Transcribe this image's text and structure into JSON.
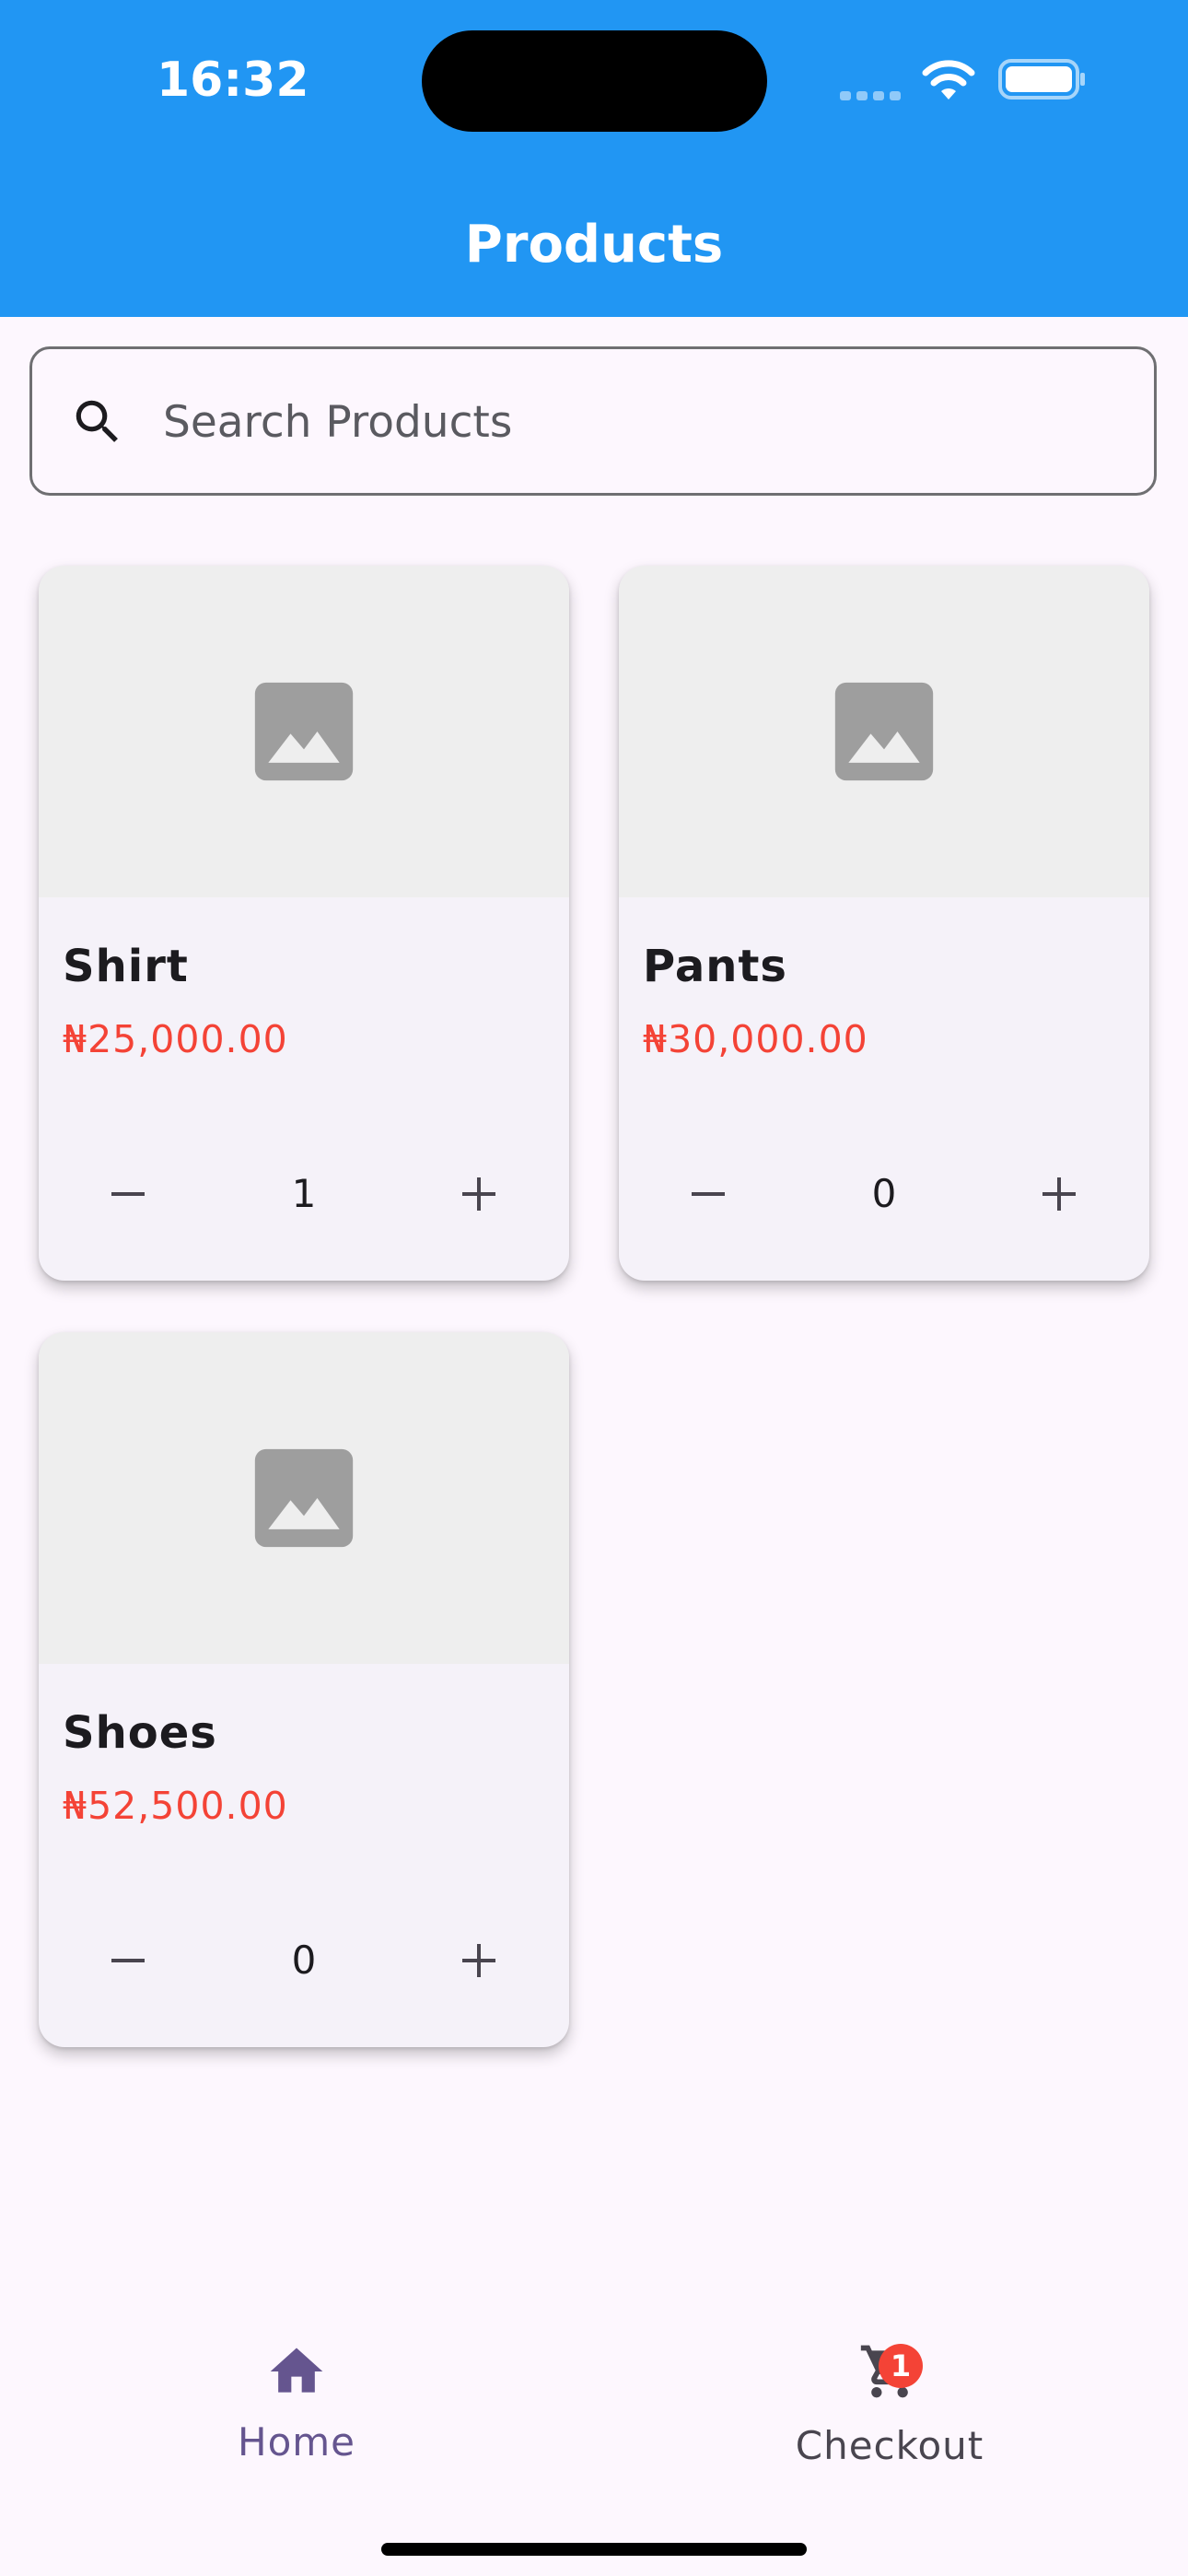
{
  "status_bar": {
    "time": "16:32"
  },
  "app_bar": {
    "title": "Products",
    "color": "#2196F3"
  },
  "search": {
    "placeholder": "Search Products",
    "value": "",
    "icon": "search-icon"
  },
  "products": [
    {
      "name": "Shirt",
      "price": "₦25,000.00",
      "quantity": "1",
      "image_icon": "image-placeholder-icon"
    },
    {
      "name": "Pants",
      "price": "₦30,000.00",
      "quantity": "0",
      "image_icon": "image-placeholder-icon"
    },
    {
      "name": "Shoes",
      "price": "₦52,500.00",
      "quantity": "0",
      "image_icon": "image-placeholder-icon"
    }
  ],
  "price_color": "#F44336",
  "bottom_nav": {
    "items": [
      {
        "label": "Home",
        "icon": "home-icon",
        "selected": true
      },
      {
        "label": "Checkout",
        "icon": "cart-icon",
        "badge": "1",
        "selected": false
      }
    ],
    "selected_color": "#65558F"
  }
}
